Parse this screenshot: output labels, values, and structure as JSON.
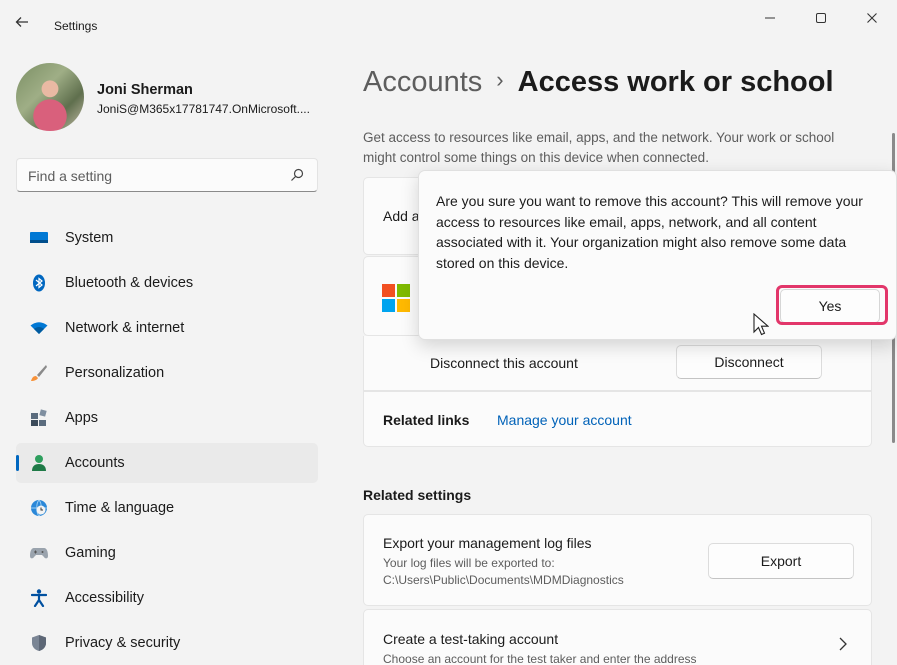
{
  "window": {
    "title": "Settings",
    "back_icon": "back-arrow-icon",
    "controls": {
      "minimize": "minimize-icon",
      "maximize": "maximize-icon",
      "close": "close-icon"
    }
  },
  "profile": {
    "name": "Joni Sherman",
    "email": "JoniS@M365x17781747.OnMicrosoft...."
  },
  "search": {
    "placeholder": "Find a setting",
    "icon": "search-icon"
  },
  "nav": {
    "items": [
      {
        "label": "System",
        "icon": "system-icon"
      },
      {
        "label": "Bluetooth & devices",
        "icon": "bluetooth-icon"
      },
      {
        "label": "Network & internet",
        "icon": "wifi-icon"
      },
      {
        "label": "Personalization",
        "icon": "brush-icon"
      },
      {
        "label": "Apps",
        "icon": "apps-icon"
      },
      {
        "label": "Accounts",
        "icon": "person-icon",
        "selected": true
      },
      {
        "label": "Time & language",
        "icon": "globe-clock-icon"
      },
      {
        "label": "Gaming",
        "icon": "gamepad-icon"
      },
      {
        "label": "Accessibility",
        "icon": "accessibility-icon"
      },
      {
        "label": "Privacy & security",
        "icon": "shield-icon"
      }
    ]
  },
  "header": {
    "parent": "Accounts",
    "separator": "›",
    "current": "Access work or school"
  },
  "description": "Get access to resources like email, apps, and the network. Your work or school might control some things on this device when connected.",
  "add_card": {
    "label": "Add a"
  },
  "account_card": {
    "logo": "microsoft-logo-icon"
  },
  "disconnect": {
    "label": "Disconnect this account",
    "button": "Disconnect"
  },
  "related_links": {
    "label": "Related links",
    "link": "Manage your account"
  },
  "related_settings": {
    "title": "Related settings",
    "export": {
      "title": "Export your management log files",
      "subtitle": "Your log files will be exported to: C:\\Users\\Public\\Documents\\MDMDiagnostics",
      "button": "Export"
    },
    "test_account": {
      "title": "Create a test-taking account",
      "subtitle": "Choose an account for the test taker and enter the address",
      "chevron": "chevron-right-icon"
    }
  },
  "dialog": {
    "message": "Are you sure you want to remove this account? This will remove your access to resources like email, apps, network, and all content associated with it. Your organization might also remove some data stored on this device.",
    "confirm": "Yes"
  },
  "colors": {
    "accent": "#0067c0",
    "highlight": "#e2366a",
    "link": "#0062b8"
  }
}
